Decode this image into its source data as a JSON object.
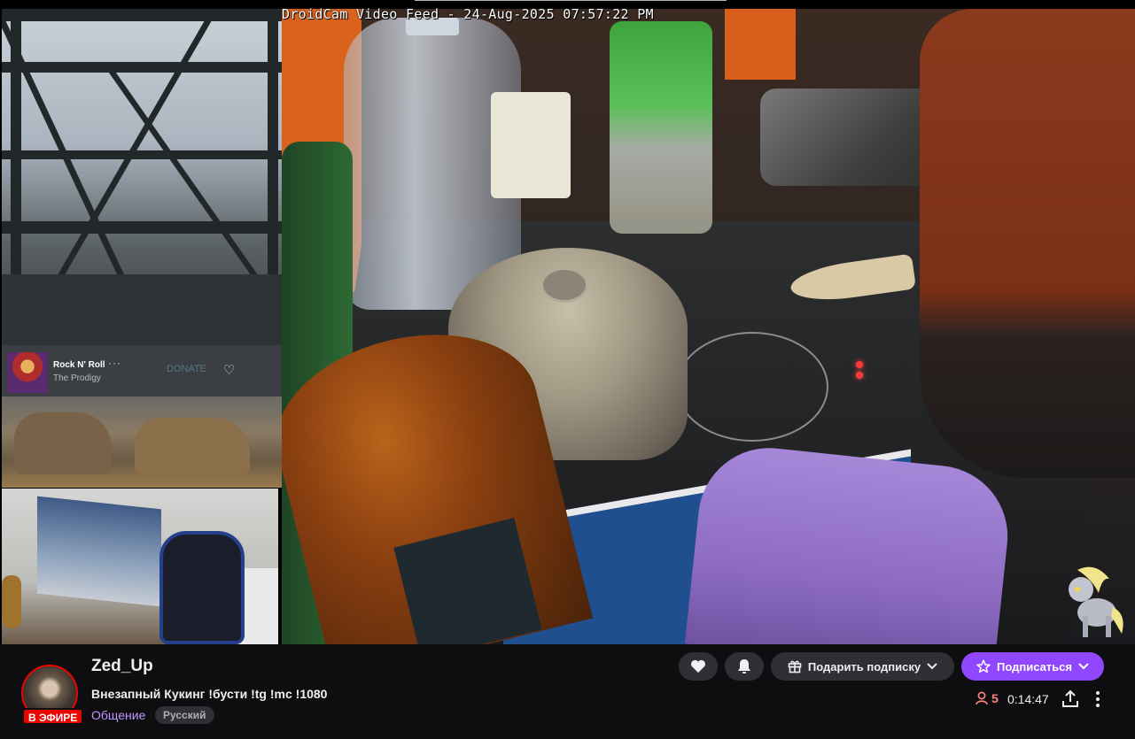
{
  "video": {
    "overlay_text": "DroidCam Video Feed - 24-Aug-2025 07:57:22 PM"
  },
  "now_playing": {
    "title": "Rock N' Roll",
    "artist": "The Prodigy",
    "more_icon": "ellipsis-icon",
    "ghost_text": "DONATE",
    "like_icon": "heart-outline-icon"
  },
  "channel": {
    "name": "Zed_Up",
    "live_badge": "В ЭФИРЕ",
    "stream_title": "Внезапный Кукинг !бусти !tg !mc !1080",
    "category": "Общение",
    "tag": "Русский"
  },
  "actions": {
    "follow_icon": "heart-icon",
    "notify_icon": "bell-icon",
    "gift_label": "Подарить подписку",
    "gift_icon": "gift-icon",
    "subscribe_label": "Подписаться",
    "subscribe_icon": "star-icon"
  },
  "stats": {
    "viewers": "5",
    "viewers_icon": "person-icon",
    "uptime": "0:14:47",
    "share_icon": "share-icon",
    "more_icon": "vertical-dots-icon"
  },
  "colors": {
    "live": "#eb0400",
    "accent": "#9147ff",
    "viewer_count": "#ff8280",
    "category": "#bf94ff"
  }
}
